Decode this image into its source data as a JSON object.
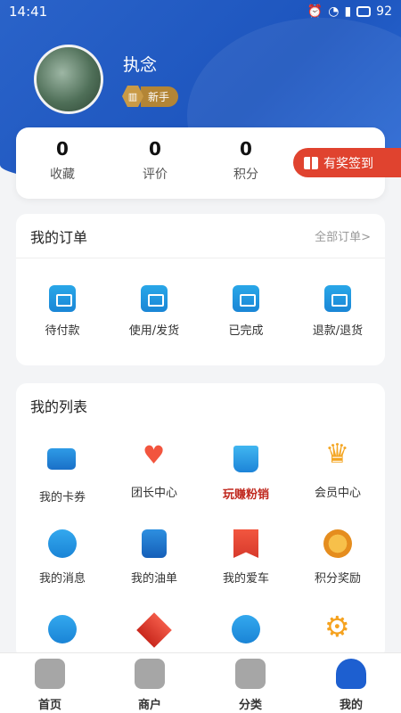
{
  "status_bar": {
    "time": "14:41",
    "battery": "92"
  },
  "profile": {
    "name": "执念",
    "level": "新手"
  },
  "stats": [
    {
      "value": "0",
      "label": "收藏"
    },
    {
      "value": "0",
      "label": "评价"
    },
    {
      "value": "0",
      "label": "积分"
    }
  ],
  "checkin_label": "有奖签到",
  "orders": {
    "title": "我的订单",
    "all_link": "全部订单>",
    "items": [
      {
        "label": "待付款",
        "icon": "wallet-icon"
      },
      {
        "label": "使用/发货",
        "icon": "clock-icon"
      },
      {
        "label": "已完成",
        "icon": "box-icon"
      },
      {
        "label": "退款/退货",
        "icon": "return-icon"
      }
    ]
  },
  "list": {
    "title": "我的列表",
    "items": [
      {
        "label": "我的卡券",
        "icon": "card-icon"
      },
      {
        "label": "团长中心",
        "icon": "heart-hands-icon"
      },
      {
        "label": "玩赚粉销",
        "icon": "shopping-bag-icon"
      },
      {
        "label": "会员中心",
        "icon": "crown-icon"
      },
      {
        "label": "我的消息",
        "icon": "mail-icon"
      },
      {
        "label": "我的油单",
        "icon": "oil-can-icon"
      },
      {
        "label": "我的爱车",
        "icon": "car-flag-icon"
      },
      {
        "label": "积分奖励",
        "icon": "medal-icon"
      }
    ]
  },
  "tabs": [
    {
      "label": "首页",
      "icon": "car-icon"
    },
    {
      "label": "商户",
      "icon": "store-icon"
    },
    {
      "label": "分类",
      "icon": "grid-icon"
    },
    {
      "label": "我的",
      "icon": "user-icon"
    }
  ],
  "colors": {
    "header_blue": "#1d55be",
    "checkin_red": "#e0432f",
    "accent_blue": "#1d5fd0"
  }
}
